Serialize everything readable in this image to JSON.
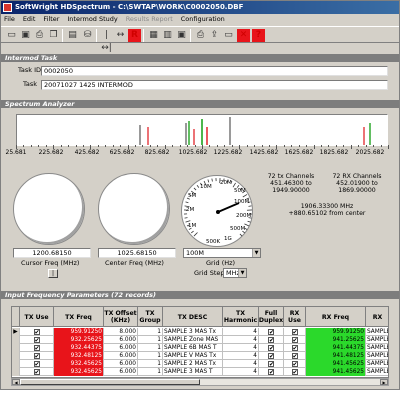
{
  "window": {
    "title": "SoftWright HDSpectrum - C:\\SWTAP\\WORK\\C0002050.DBF"
  },
  "menu": [
    {
      "label": "File",
      "enabled": true
    },
    {
      "label": "Edit",
      "enabled": true
    },
    {
      "label": "Filter",
      "enabled": true
    },
    {
      "label": "Intermod Study",
      "enabled": true
    },
    {
      "label": "Results Report",
      "enabled": false
    },
    {
      "label": "Configuration",
      "enabled": true
    }
  ],
  "toolbar_icons": [
    "folder-icon",
    "save-icon",
    "print-icon",
    "copy-icon",
    "book-icon",
    "database-icon",
    "fit-width-icon",
    "expand-icon",
    "reset-r-icon",
    "calculator-icon",
    "table-icon",
    "save2-icon",
    "printer2-icon",
    "export-icon",
    "close-x-icon",
    "help-icon"
  ],
  "intermod_task": {
    "header": "Intermod Task",
    "task_id_label": "Task ID:",
    "task_id": "0002050",
    "task_label": "Task",
    "task": "20071027 1425 INTERMOD"
  },
  "spectrum_analyzer": {
    "header": "Spectrum Analyzer",
    "tick_labels": [
      "25.681",
      "225.682",
      "425.682",
      "625.682",
      "825.682",
      "1025.682",
      "1225.682",
      "1425.682",
      "1625.682",
      "1825.682",
      "2025.682"
    ],
    "signal_colors": {
      "black": "#000000",
      "green": "#1fa31f",
      "red": "#e0141a"
    }
  },
  "controls": {
    "cursor_freq": "1200.68150",
    "cursor_freq_label": "Cursor Freq (MHz)",
    "center_freq": "1025.68150",
    "center_freq_label": "Center Freq (MHz)",
    "cursor_button": "|",
    "gauge_labels": [
      "10M",
      "20M",
      "50M",
      "100M",
      "200M",
      "500M",
      "1G",
      "2G",
      "5M",
      "2M",
      "1M",
      "500K"
    ],
    "grid_value": "100M",
    "grid_label": "Grid (Hz)",
    "grid_step_label": "Grid Step",
    "grid_step_unit": "MHz"
  },
  "info": {
    "tx_channels": "72 tx Channels",
    "tx_range_low": "451.46300 to",
    "tx_range_high": "1949.90000",
    "rx_channels": "72 RX Channels",
    "rx_range_low": "452.01900 to",
    "rx_range_high": "1869.90000",
    "cursor_mhz": "1906.33300 MHz",
    "cursor_offset": "+880.65102 from center"
  },
  "table": {
    "header": "Input Frequency Parameters (72 records)",
    "columns": [
      "TX Use",
      "TX Freq",
      "TX Offset (KHz)",
      "TX Group",
      "TX DESC",
      "TX Harmonic",
      "Full Duplex",
      "RX Use",
      "RX Freq",
      "RX"
    ],
    "rows": [
      {
        "tx_use": "✔",
        "tx_freq": "959.91250",
        "offset": "8.000",
        "group": "1",
        "desc": "SAMPLE 3 MAS Tx",
        "harmonic": "4",
        "duplex": "✔",
        "rx_use": "✔",
        "rx_freq": "959.91250",
        "rx": "SAMPLE"
      },
      {
        "tx_use": "✔",
        "tx_freq": "932.25625",
        "offset": "6.000",
        "group": "1",
        "desc": "SAMPLE Zone MAS",
        "harmonic": "4",
        "duplex": "✔",
        "rx_use": "✔",
        "rx_freq": "941.25625",
        "rx": "SAMPLE"
      },
      {
        "tx_use": "✔",
        "tx_freq": "932.44375",
        "offset": "6.000",
        "group": "1",
        "desc": "SAMPLE 6B MAS T",
        "harmonic": "4",
        "duplex": "✔",
        "rx_use": "✔",
        "rx_freq": "941.44375",
        "rx": "SAMPLE"
      },
      {
        "tx_use": "✔",
        "tx_freq": "932.48125",
        "offset": "6.000",
        "group": "1",
        "desc": "SAMPLE V MAS Tx",
        "harmonic": "4",
        "duplex": "✔",
        "rx_use": "✔",
        "rx_freq": "941.48125",
        "rx": "SAMPLE"
      },
      {
        "tx_use": "✔",
        "tx_freq": "932.45625",
        "offset": "6.000",
        "group": "1",
        "desc": "SAMPLE 2 MAS Tx",
        "harmonic": "4",
        "duplex": "✔",
        "rx_use": "✔",
        "rx_freq": "941.45625",
        "rx": "SAMPLE"
      },
      {
        "tx_use": "✔",
        "tx_freq": "932.45625",
        "offset": "6.000",
        "group": "1",
        "desc": "SAMPLE 3 MAS T",
        "harmonic": "4",
        "duplex": "✔",
        "rx_use": "✔",
        "rx_freq": "941.45625",
        "rx": "SAMPLE"
      }
    ]
  }
}
